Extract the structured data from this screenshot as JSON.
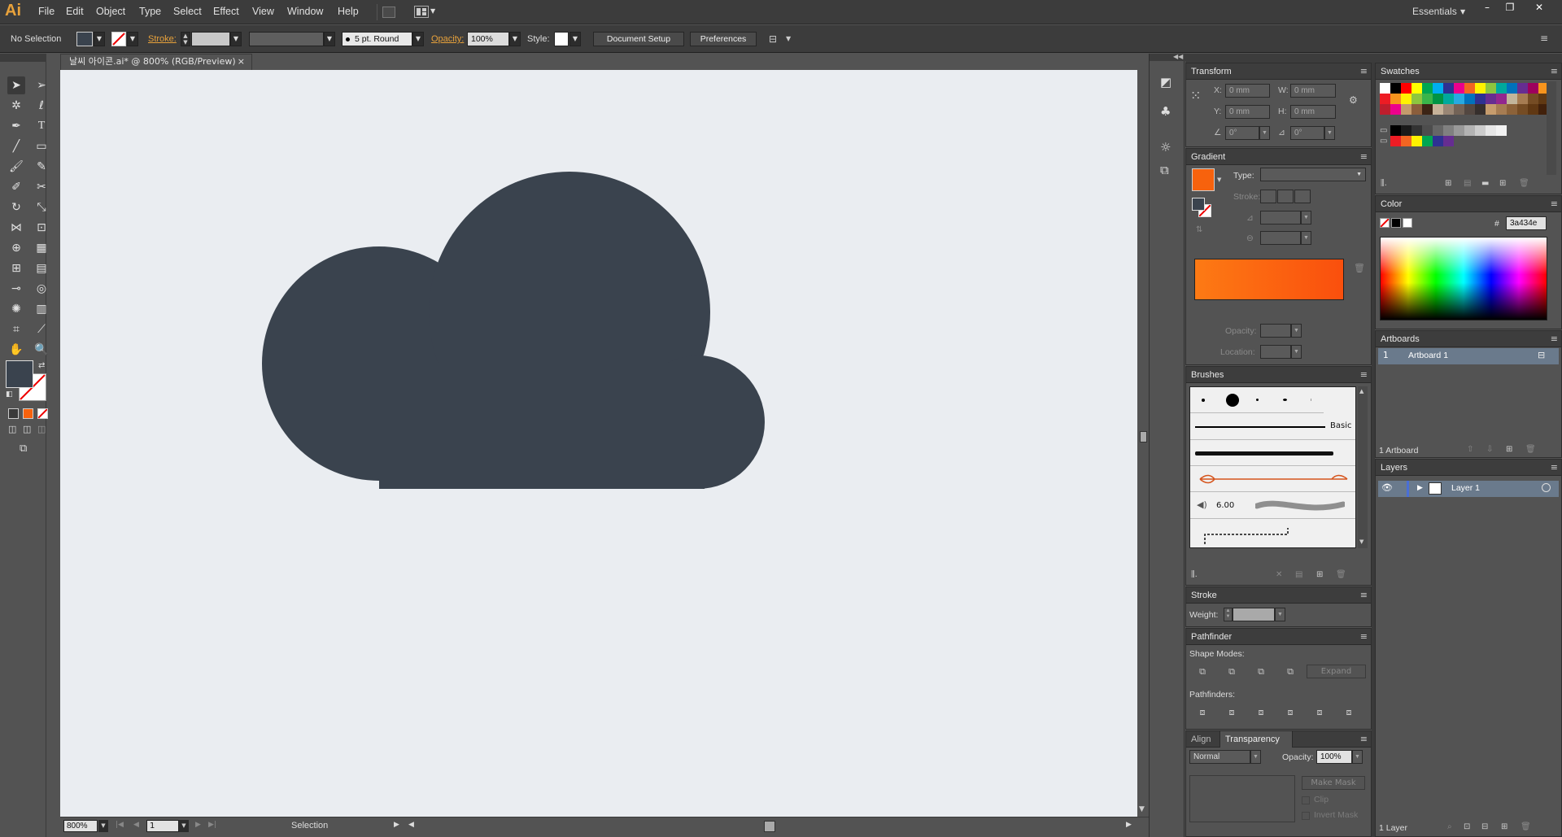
{
  "app": {
    "logo": "Ai",
    "workspace": "Essentials"
  },
  "menu": [
    "File",
    "Edit",
    "Object",
    "Type",
    "Select",
    "Effect",
    "View",
    "Window",
    "Help"
  ],
  "window_controls": {
    "minimize": "–",
    "restore": "❐",
    "close": "✕"
  },
  "control_bar": {
    "selection": "No Selection",
    "stroke_label": "Stroke:",
    "brush_value": "5 pt. Round",
    "opacity_label": "Opacity:",
    "opacity_value": "100%",
    "style_label": "Style:",
    "document_setup": "Document Setup",
    "preferences": "Preferences"
  },
  "document": {
    "tab_title": "날씨 아이콘.ai* @ 800% (RGB/Preview)",
    "close": "×"
  },
  "artwork": {
    "cloud_color": "#3a434e",
    "canvas_color": "#eaedf1"
  },
  "status_bar": {
    "zoom": "800%",
    "artboard_index": "1",
    "tool": "Selection"
  },
  "transform": {
    "title": "Transform",
    "x_label": "X:",
    "x_value": "0 mm",
    "y_label": "Y:",
    "y_value": "0 mm",
    "w_label": "W:",
    "w_value": "0 mm",
    "h_label": "H:",
    "h_value": "0 mm",
    "rot_value": "0°",
    "shear_value": "0°"
  },
  "gradient": {
    "title": "Gradient",
    "type_label": "Type:",
    "stroke_label": "Stroke:",
    "opacity_label": "Opacity:",
    "location_label": "Location:",
    "swatch_color": "#f7620d",
    "start_color": "#fd7a14",
    "end_color": "#fa4f0d"
  },
  "brushes": {
    "title": "Brushes",
    "basic_label": "Basic",
    "size_value": "6.00"
  },
  "stroke": {
    "title": "Stroke",
    "weight_label": "Weight:"
  },
  "pathfinder": {
    "title": "Pathfinder",
    "shape_modes_label": "Shape Modes:",
    "expand_label": "Expand",
    "pathfinders_label": "Pathfinders:"
  },
  "transparency": {
    "align_tab": "Align",
    "title": "Transparency",
    "blend_mode": "Normal",
    "opacity_label": "Opacity:",
    "opacity_value": "100%",
    "make_mask": "Make Mask",
    "clip_label": "Clip",
    "invert_label": "Invert Mask"
  },
  "swatches": {
    "title": "Swatches",
    "row1": [
      "#ffffff",
      "#000000",
      "#ff0000",
      "#ffff00",
      "#00a651",
      "#00aeef",
      "#2e3192",
      "#ec008c",
      "#f26522",
      "#fff200",
      "#8dc63f",
      "#00a99d",
      "#0072bc",
      "#662d91",
      "#9e005d",
      "#f7941d"
    ],
    "row2": [
      "#ed1c24",
      "#f7941d",
      "#fff200",
      "#8dc63f",
      "#39b54a",
      "#009444",
      "#00a99d",
      "#27aae1",
      "#0072bc",
      "#2e3192",
      "#662d91",
      "#92278f",
      "#c2b59b",
      "#a67c52",
      "#754c24",
      "#603913"
    ],
    "row3": [
      "#be1e2d",
      "#ec008c",
      "#c49a6c",
      "#8b5e3c",
      "#3c2415",
      "#c7b299",
      "#998675",
      "#736357",
      "#534741",
      "#362f2d",
      "#c69c6d",
      "#a67c52",
      "#8c6239",
      "#754c24",
      "#603813",
      "#42210b"
    ],
    "grays": [
      "#000000",
      "#1a1a1a",
      "#333333",
      "#4d4d4d",
      "#666666",
      "#808080",
      "#999999",
      "#b3b3b3",
      "#cccccc",
      "#e6e6e6",
      "#f2f2f2"
    ],
    "group": [
      "#ed1c24",
      "#f26522",
      "#fff200",
      "#00a651",
      "#2e3192",
      "#662d91"
    ]
  },
  "color": {
    "title": "Color",
    "hash": "#",
    "hex_value": "3a434e"
  },
  "artboards": {
    "title": "Artboards",
    "row_index": "1",
    "row_name": "Artboard 1",
    "count_label": "1 Artboard"
  },
  "layers": {
    "title": "Layers",
    "layer_name": "Layer 1",
    "count_label": "1 Layer"
  }
}
